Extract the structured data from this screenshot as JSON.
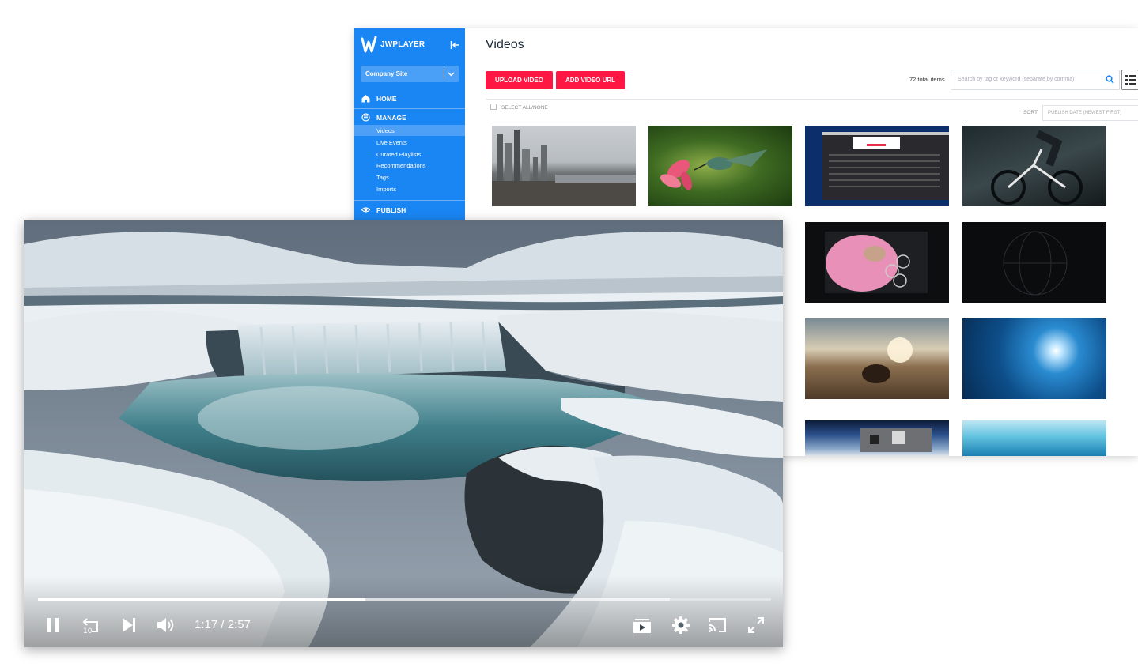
{
  "dashboard": {
    "logo_text": "JWPLAYER",
    "site_select": "Company Site",
    "nav": {
      "home": "HOME",
      "manage": "MANAGE",
      "manage_items": [
        "Videos",
        "Live Events",
        "Curated Playlists",
        "Recommendations",
        "Tags",
        "Imports"
      ],
      "publish": "PUBLISH"
    },
    "page_title": "Videos",
    "buttons": {
      "upload": "UPLOAD VIDEO",
      "add_url": "ADD VIDEO URL"
    },
    "total_items": "72 total items",
    "search_placeholder": "Search by tag or keyword (separate by comma)",
    "select_all": "SELECT ALL/NONE",
    "sort_label": "SORT",
    "sort_value": "PUBLISH DATE (NEWEST FIRST)",
    "accent_color": "#1a86f4",
    "button_color": "#ff1744"
  },
  "player": {
    "time_display": "1:17 / 2:57",
    "progress_fraction": 0.447,
    "buffered_fraction": 0.862,
    "icons": [
      "pause-icon",
      "rewind-10-icon",
      "next-icon",
      "volume-icon",
      "playlist-icon",
      "settings-icon",
      "cast-icon",
      "fullscreen-icon"
    ]
  }
}
